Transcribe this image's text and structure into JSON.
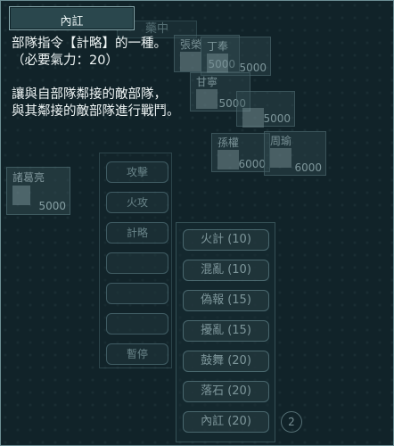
{
  "tab": {
    "label": "內訌"
  },
  "description": {
    "lines": [
      "部隊指令【計略】的一種。",
      "（必要氣力：20）",
      "",
      "讓與自部隊鄰接的敵部隊，",
      "與其鄰接的敵部隊進行戰鬥。"
    ]
  },
  "background": {
    "top_label": "藥中",
    "units": [
      {
        "name": "張榮",
        "value": "5000"
      },
      {
        "name": "丁奉",
        "value": "5000"
      },
      {
        "name": "甘寧",
        "value": "5000"
      },
      {
        "name": "孫權",
        "value": "6000"
      },
      {
        "name": "周瑜",
        "value": "6000"
      },
      {
        "name": "",
        "value": "5000"
      }
    ],
    "left_panel": {
      "name": "諸葛亮",
      "value": "5000"
    },
    "commands": [
      "攻擊",
      "火攻",
      "計略",
      "",
      "",
      "",
      "暫停"
    ],
    "options": [
      "火計 (10)",
      "混亂 (10)",
      "偽報 (15)",
      "擾亂 (15)",
      "鼓舞 (20)",
      "落石 (20)",
      "內訌 (20)"
    ],
    "help_badge": "2"
  }
}
